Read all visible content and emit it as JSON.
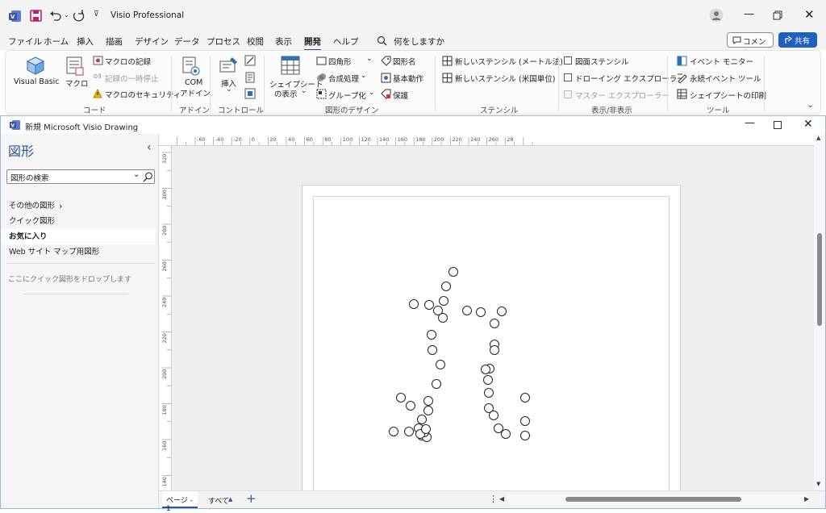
{
  "titlebar": {
    "app_title": "Visio Professional"
  },
  "menu": {
    "items": [
      "ファイル",
      "ホーム",
      "挿入",
      "描画",
      "デザイン",
      "データ",
      "プロセス",
      "校閲",
      "表示",
      "開発",
      "ヘルプ"
    ],
    "active": "開発",
    "search_placeholder": "何をしますか",
    "comment_label": "コメント",
    "share_label": "共有"
  },
  "ribbon": {
    "code": {
      "visual_basic": "Visual Basic",
      "macro": "マクロ",
      "record_macro": "マクロの記録",
      "pause_recording": "記録の一時停止",
      "macro_security": "マクロのセキュリティ",
      "group_label": "コード"
    },
    "addins": {
      "com_line1": "COM",
      "com_line2": "アドイン",
      "group_label": "アドイン"
    },
    "controls": {
      "insert": "挿入",
      "group_label": "コントロール"
    },
    "shape_design": {
      "show_shapesheet_line1": "シェイプシート",
      "show_shapesheet_line2": "の表示",
      "rectangle": "四角形",
      "operations": "合成処理",
      "group": "グループ化",
      "shape_name": "図形名",
      "behavior": "基本動作",
      "protection": "保護",
      "group_label": "図形のデザイン"
    },
    "stencil": {
      "new_metric": "新しいステンシル (メートル法)",
      "new_us": "新しいステンシル (米国単位)",
      "group_label": "ステンシル"
    },
    "show_hide": {
      "document_stencil": "図面ステンシル",
      "drawing_explorer": "ドローイング エクスプローラー",
      "master_explorer": "マスター エクスプローラー",
      "group_label": "表示/非表示"
    },
    "tools": {
      "event_monitor": "イベント モニター",
      "persistent_events": "永続イベント ツール",
      "print_shapesheet": "シェイプシートの印刷",
      "group_label": "ツール"
    }
  },
  "document": {
    "title": "新規 Microsoft Visio Drawing"
  },
  "sidebar": {
    "title": "図形",
    "search_placeholder": "図形の検索",
    "more_shapes": "その他の図形",
    "items": [
      "クイック図形",
      "お気に入り",
      "Web サイト マップ用図形"
    ],
    "selected": "お気に入り",
    "drop_hint": "ここにクイック図形をドロップします"
  },
  "ruler": {
    "h_labels": [
      "-60",
      "-40",
      "-20",
      "0",
      "20",
      "40",
      "60",
      "80",
      "100",
      "120",
      "140",
      "160",
      "180",
      "200",
      "220",
      "240",
      "260",
      "28"
    ],
    "v_labels": [
      "320",
      "300",
      "280",
      "260",
      "240",
      "220",
      "200",
      "180",
      "160",
      "140"
    ]
  },
  "status": {
    "page_tab": "ページ - 1",
    "all_label": "すべて"
  },
  "colors": {
    "accent": "#2b579a",
    "share_button": "#1f5fbf",
    "save_icon": "#b7226f",
    "visio_icon": "#3955a3"
  },
  "shapes": {
    "circle_count": 51
  }
}
